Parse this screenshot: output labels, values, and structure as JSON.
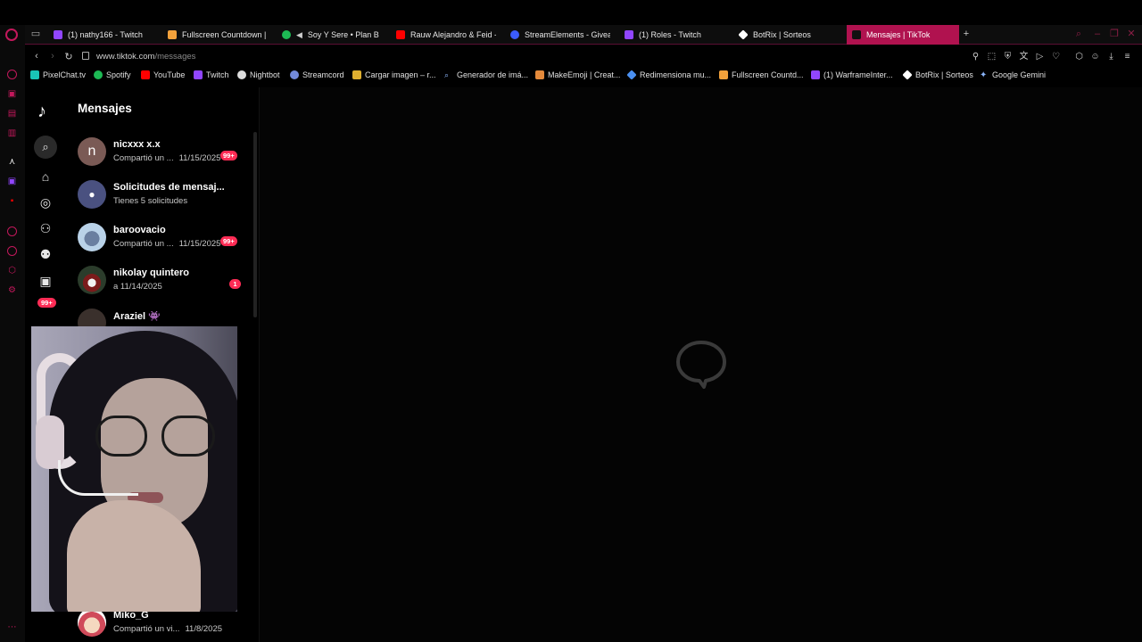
{
  "tabs": [
    {
      "label": "(1) nathy166 - Twitch",
      "color": "#9146ff",
      "active": false
    },
    {
      "label": "Fullscreen Countdown | T",
      "color": "#f2a13b",
      "active": false
    },
    {
      "label": "Soy Y Sere • Plan B",
      "color": "#1db954",
      "active": false
    },
    {
      "label": "Rauw Alejandro & Feid - F",
      "color": "#ff0000",
      "active": false
    },
    {
      "label": "StreamElements - Giveaw",
      "color": "#3b5cff",
      "active": false
    },
    {
      "label": "(1) Roles - Twitch",
      "color": "#9146ff",
      "active": false
    },
    {
      "label": "BotRix | Sorteos",
      "color": "#ffffff",
      "active": false
    },
    {
      "label": "Mensajes | TikTok",
      "color": "#ffffff",
      "active": true
    }
  ],
  "address": {
    "url_host": "www.tiktok.com",
    "url_path": "/messages"
  },
  "bookmarks": [
    {
      "label": "PixelChat.tv",
      "color": "#19c4b6"
    },
    {
      "label": "Spotify",
      "color": "#1db954"
    },
    {
      "label": "YouTube",
      "color": "#ff0000"
    },
    {
      "label": "Twitch",
      "color": "#9146ff"
    },
    {
      "label": "Nightbot",
      "color": "#dddddd"
    },
    {
      "label": "Streamcord",
      "color": "#7289da"
    },
    {
      "label": "Cargar imagen – r...",
      "color": "#e0b030"
    },
    {
      "label": "Generador de imá...",
      "color": "#8ab4f8"
    },
    {
      "label": "MakeEmoji | Creat...",
      "color": "#e58a3b"
    },
    {
      "label": "Redimensiona mu...",
      "color": "#4a8ff0"
    },
    {
      "label": "Fullscreen Countd...",
      "color": "#f2a13b"
    },
    {
      "label": "(1) WarframeInter...",
      "color": "#9146ff"
    },
    {
      "label": "BotRix | Sorteos",
      "color": "#ffffff"
    },
    {
      "label": "Google Gemini",
      "color": "#8ab4f8"
    }
  ],
  "messages": {
    "title": "Mensajes",
    "rail_badge": "99+",
    "conversations": [
      {
        "name": "nicxxx x.x",
        "preview": "Compartió un ...",
        "date": "11/15/2025",
        "badge": "99+"
      },
      {
        "name": "Solicitudes de mensaj...",
        "preview": "Tienes 5 solicitudes",
        "date": "",
        "badge": ""
      },
      {
        "name": "baroovacio",
        "preview": "Compartió un ...",
        "date": "11/15/2025",
        "badge": "99+"
      },
      {
        "name": "nikolay quintero",
        "preview": "a 11/14/2025",
        "date": "",
        "badge": "1"
      },
      {
        "name": "Araziel 👾",
        "preview": "",
        "date": "",
        "badge": ""
      },
      {
        "name": "Miko_G",
        "preview": "Compartió un vi...",
        "date": "11/8/2025",
        "badge": ""
      }
    ]
  }
}
